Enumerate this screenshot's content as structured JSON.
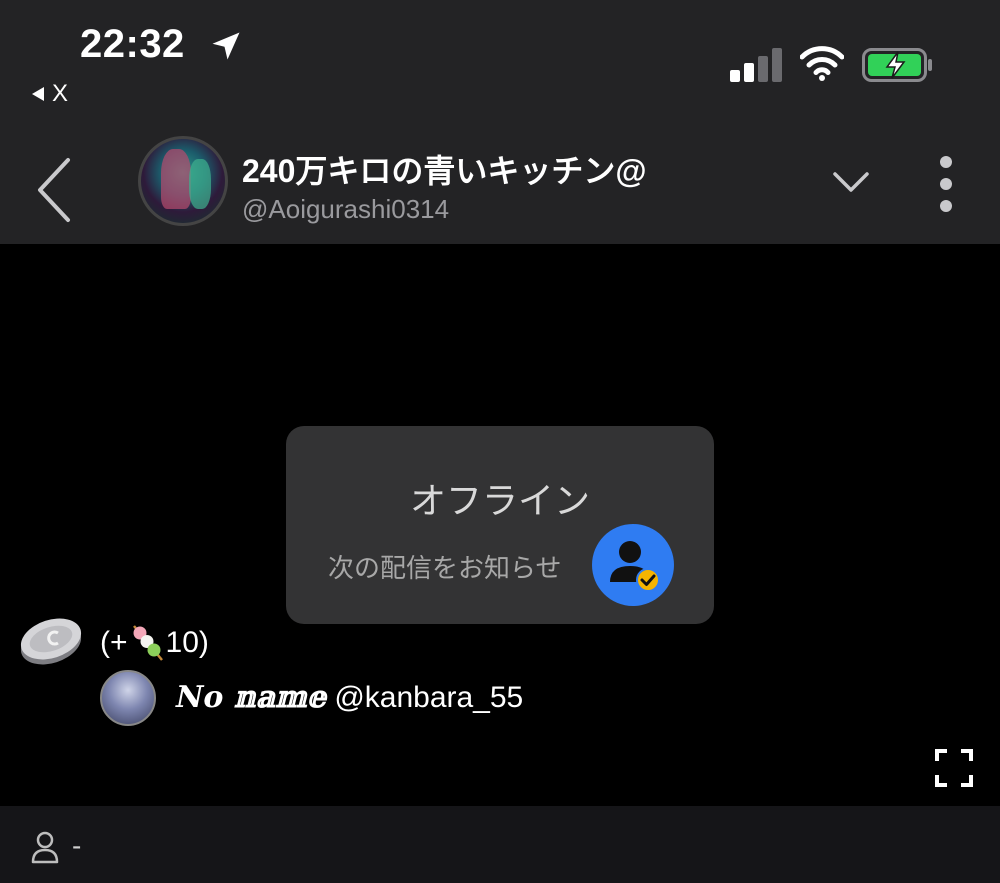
{
  "status_bar": {
    "time": "22:32",
    "back_app_label": "X",
    "icons": [
      "location-arrow-icon",
      "cellular-signal-icon",
      "wifi-icon",
      "battery-charging-icon"
    ],
    "battery_color": "#31d158"
  },
  "nav": {
    "channel_name": "240万キロの青いキッチン@",
    "channel_handle": "@Aoigurashi0314",
    "icons": [
      "back-chevron-icon",
      "chevron-down-icon",
      "more-vertical-icon"
    ]
  },
  "offline_card": {
    "title": "オフライン",
    "notify_label": "次の配信をお知らせ",
    "accent": "#2f7cf2",
    "badge_color": "#f5b400"
  },
  "gift": {
    "prefix": "(+",
    "amount": "10)",
    "icons": [
      "coin-icon",
      "dango-icon"
    ]
  },
  "commenter": {
    "display_name": "𝑵𝒐 𝕟𝕒𝕞𝕖",
    "handle": "@kanbara_55"
  },
  "bottom_bar": {
    "viewer_count": "-",
    "icons": [
      "person-icon",
      "fullscreen-icon"
    ]
  },
  "colors": {
    "header_bg": "#232325",
    "video_bg": "#000000",
    "card_bg": "#333334",
    "bottom_bg": "#151518"
  }
}
